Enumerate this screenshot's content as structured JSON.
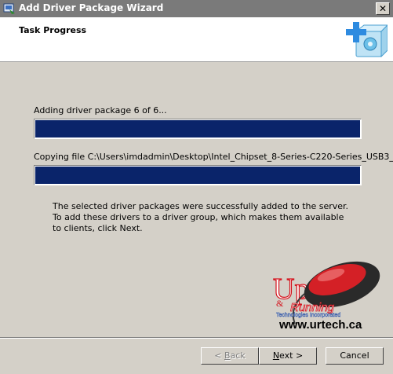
{
  "window": {
    "title": "Add Driver Package Wizard",
    "close_label": "✕"
  },
  "header": {
    "title": "Task Progress"
  },
  "progress": {
    "line1": "Adding driver package 6 of 6...",
    "bar1_fraction": 1.0,
    "line2": "Copying file C:\\Users\\imdadmin\\Desktop\\Intel_Chipset_8-Series-C220-Series_USB3_...",
    "bar2_fraction": 1.0
  },
  "message": "The selected driver packages were successfully added to the server. To add these drivers to a driver group, which makes them available to clients, click Next.",
  "watermark": {
    "logo_up": "Up",
    "logo_amp": "&",
    "logo_running": "Running",
    "logo_tagline": "Technologies Incorporated",
    "url": "www.urtech.ca"
  },
  "buttons": {
    "back_label_u": "B",
    "back_label": "ack",
    "back_prefix": "< ",
    "next_label_u": "N",
    "next_label": "ext >",
    "cancel_label": "Cancel"
  },
  "colors": {
    "progress_fill": "#0a246a",
    "title_bar": "#7a7a7a",
    "dialog_bg": "#d4d0c8"
  }
}
